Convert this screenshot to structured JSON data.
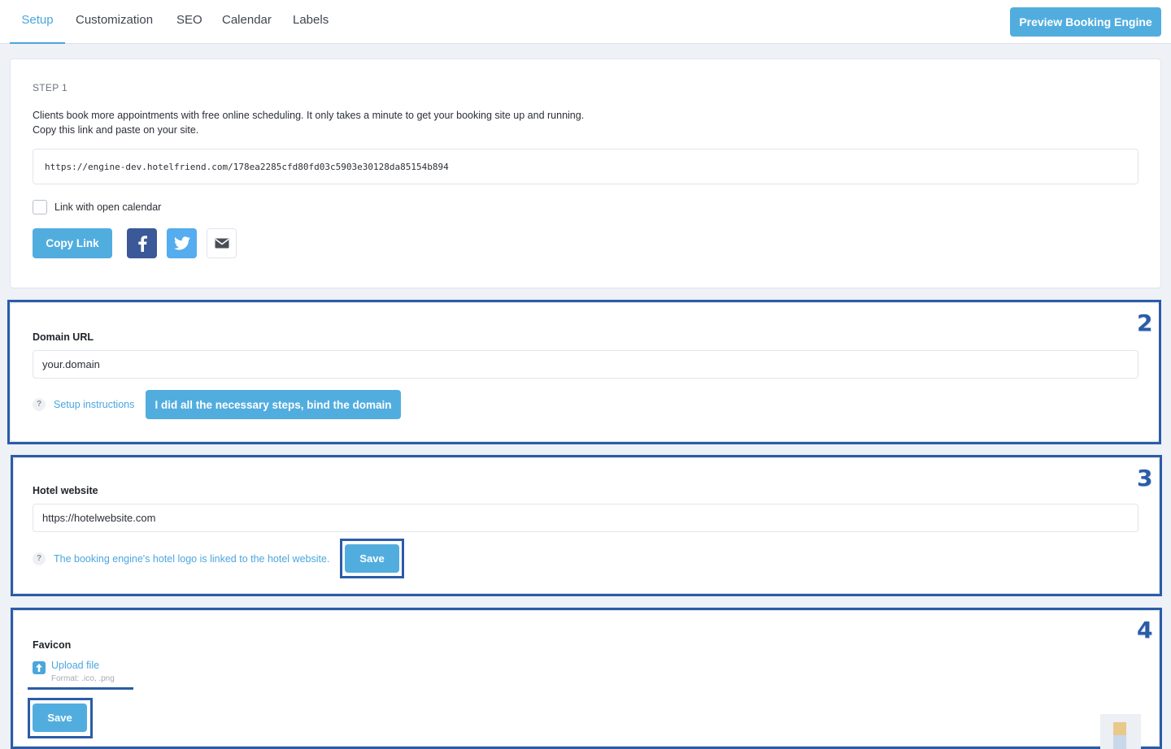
{
  "nav": {
    "tabs": [
      {
        "label": "Setup",
        "active": true
      },
      {
        "label": "Customization",
        "active": false
      },
      {
        "label": "SEO",
        "active": false
      },
      {
        "label": "Calendar",
        "active": false
      },
      {
        "label": "Labels",
        "active": false
      }
    ],
    "preview_button": "Preview Booking Engine"
  },
  "step1": {
    "step_label": "STEP 1",
    "description_line1": "Clients book more appointments with free online scheduling. It only takes a minute to get your booking site up and running.",
    "description_line2": "Copy this link and paste on your site.",
    "booking_link": "https://engine-dev.hotelfriend.com/178ea2285cfd80fd03c5903e30128da85154b894",
    "open_calendar_checkbox": {
      "label": "Link with open calendar",
      "checked": false
    },
    "copy_button": "Copy Link",
    "share_icons": [
      "facebook-icon",
      "twitter-icon",
      "email-icon"
    ]
  },
  "domain": {
    "marker": "2",
    "label": "Domain URL",
    "value": "your.domain",
    "help_icon": "?",
    "help_link": "Setup instructions",
    "bind_button": "I did all the necessary steps, bind the domain"
  },
  "website": {
    "marker": "3",
    "label": "Hotel website",
    "value": "https://hotelwebsite.com",
    "help_icon": "?",
    "help_link": "The booking engine's hotel logo is linked to the hotel website.",
    "save_button": "Save"
  },
  "favicon": {
    "marker": "4",
    "label": "Favicon",
    "upload_link": "Upload file",
    "format_note": "Format: .ico, .png",
    "save_button": "Save"
  },
  "colors": {
    "accent": "#4ba6de",
    "button": "#52addf",
    "annotation": "#2b5ca7",
    "facebook": "#3b5998",
    "twitter": "#55acee"
  }
}
